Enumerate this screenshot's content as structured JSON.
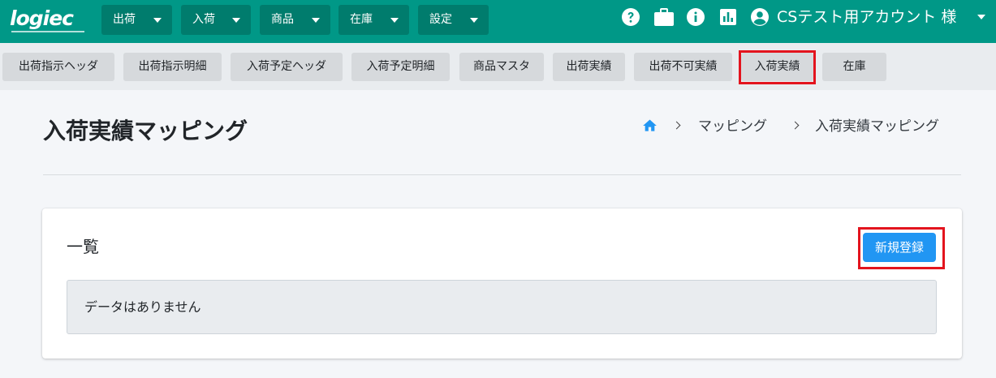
{
  "logo": {
    "text": "logiec"
  },
  "nav": {
    "menus": [
      {
        "label": "出荷"
      },
      {
        "label": "入荷"
      },
      {
        "label": "商品"
      },
      {
        "label": "在庫"
      },
      {
        "label": "設定"
      }
    ],
    "icons": [
      "help-icon",
      "briefcase-icon",
      "info-icon",
      "chart-icon"
    ],
    "user_label": "CSテスト用アカウント 様"
  },
  "subnav": {
    "tabs": [
      {
        "label": "出荷指示ヘッダ"
      },
      {
        "label": "出荷指示明細"
      },
      {
        "label": "入荷予定ヘッダ"
      },
      {
        "label": "入荷予定明細"
      },
      {
        "label": "商品マスタ"
      },
      {
        "label": "出荷実績"
      },
      {
        "label": "出荷不可実績"
      },
      {
        "label": "入荷実績",
        "highlighted": true
      },
      {
        "label": "在庫"
      }
    ]
  },
  "page": {
    "title": "入荷実績マッピング",
    "breadcrumb": [
      "マッピング",
      "入荷実績マッピング"
    ]
  },
  "card": {
    "title": "一覧",
    "new_button_label": "新規登録",
    "empty_message": "データはありません"
  },
  "colors": {
    "topbar": "#009887",
    "menu_button": "#007c6d",
    "primary": "#2196f3",
    "highlight": "#e3141e"
  }
}
